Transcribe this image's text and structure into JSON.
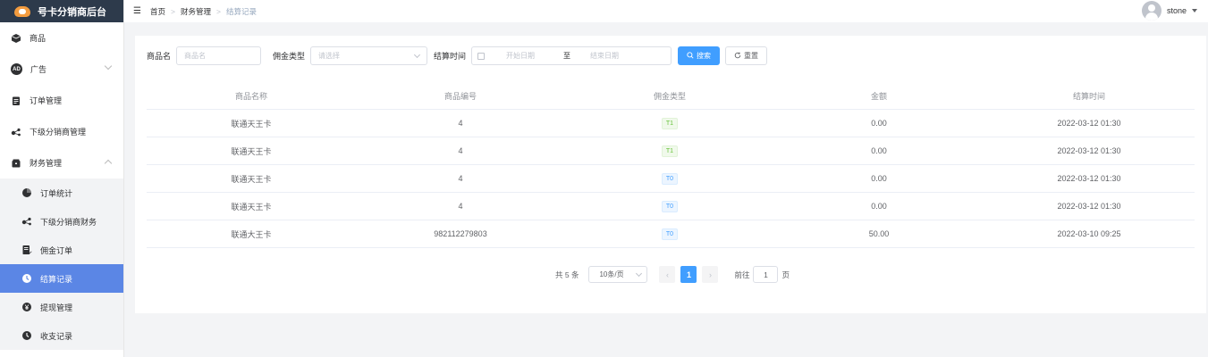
{
  "app": {
    "title": "号卡分销商后台",
    "colors": {
      "accent": "#409eff",
      "sidebar_active": "#5b86e5",
      "brand_bg": "#2d3a4b"
    }
  },
  "sidebar": {
    "items": [
      {
        "label": "商品",
        "icon": "box-icon"
      },
      {
        "label": "广告",
        "icon": "ad-icon",
        "badge": "AD"
      },
      {
        "label": "订单管理",
        "icon": "clipboard-icon"
      },
      {
        "label": "下级分销商管理",
        "icon": "share-nodes-icon"
      },
      {
        "label": "财务管理",
        "icon": "wallet-icon"
      }
    ],
    "finance_sub": [
      {
        "label": "订单统计",
        "icon": "pie-chart-icon"
      },
      {
        "label": "下级分销商财务",
        "icon": "share-nodes-icon"
      },
      {
        "label": "佣金订单",
        "icon": "document-edit-icon"
      },
      {
        "label": "结算记录",
        "icon": "clock-icon",
        "active": true
      },
      {
        "label": "提现管理",
        "icon": "yen-circle-icon"
      },
      {
        "label": "收支记录",
        "icon": "clock-icon"
      }
    ]
  },
  "header": {
    "fold_icon": "menu-fold-icon",
    "breadcrumb": [
      "首页",
      "财务管理",
      "结算记录"
    ],
    "user": "stone"
  },
  "filters": {
    "name_label": "商品名",
    "name_placeholder": "商品名",
    "type_label": "佣金类型",
    "type_placeholder": "请选择",
    "time_label": "结算时间",
    "start_placeholder": "开始日期",
    "range_sep": "至",
    "end_placeholder": "结束日期",
    "search_label": "搜索",
    "reset_label": "重置"
  },
  "table": {
    "headers": [
      "商品名称",
      "商品编号",
      "佣金类型",
      "金额",
      "结算时间"
    ],
    "rows": [
      {
        "name": "联通天王卡",
        "code": "4",
        "type": "T1",
        "amount": "0.00",
        "time": "2022-03-12 01:30"
      },
      {
        "name": "联通天王卡",
        "code": "4",
        "type": "T1",
        "amount": "0.00",
        "time": "2022-03-12 01:30"
      },
      {
        "name": "联通天王卡",
        "code": "4",
        "type": "T0",
        "amount": "0.00",
        "time": "2022-03-12 01:30"
      },
      {
        "name": "联通天王卡",
        "code": "4",
        "type": "T0",
        "amount": "0.00",
        "time": "2022-03-12 01:30"
      },
      {
        "name": "联通大王卡",
        "code": "982112279803",
        "type": "T0",
        "amount": "50.00",
        "time": "2022-03-10 09:25"
      }
    ]
  },
  "pagination": {
    "total": "共 5 条",
    "page_size": "10条/页",
    "current_page": "1",
    "goto_label": "前往",
    "goto_value": "1",
    "page_unit": "页"
  }
}
